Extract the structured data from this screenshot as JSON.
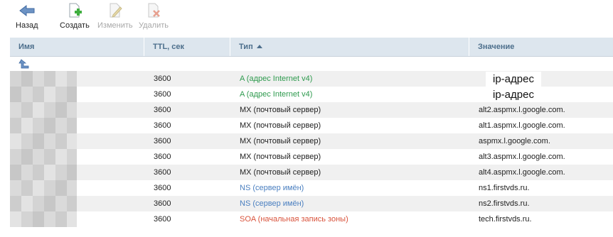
{
  "toolbar": {
    "back_label": "Назад",
    "create_label": "Создать",
    "edit_label": "Изменить",
    "delete_label": "Удалить"
  },
  "columns": {
    "name": "Имя",
    "ttl": "TTL, сек",
    "type": "Тип",
    "value": "Значение"
  },
  "rows": [
    {
      "ttl": "3600",
      "type": "A (адрес Internet v4)",
      "type_class": "a",
      "value": "ip-адрес"
    },
    {
      "ttl": "3600",
      "type": "A (адрес Internet v4)",
      "type_class": "a",
      "value": "ip-адрес"
    },
    {
      "ttl": "3600",
      "type": "MX (почтовый сервер)",
      "type_class": "mx",
      "value": "alt2.aspmx.l.google.com."
    },
    {
      "ttl": "3600",
      "type": "MX (почтовый сервер)",
      "type_class": "mx",
      "value": "alt1.aspmx.l.google.com."
    },
    {
      "ttl": "3600",
      "type": "MX (почтовый сервер)",
      "type_class": "mx",
      "value": "aspmx.l.google.com."
    },
    {
      "ttl": "3600",
      "type": "MX (почтовый сервер)",
      "type_class": "mx",
      "value": "alt3.aspmx.l.google.com."
    },
    {
      "ttl": "3600",
      "type": "MX (почтовый сервер)",
      "type_class": "mx",
      "value": "alt4.aspmx.l.google.com."
    },
    {
      "ttl": "3600",
      "type": "NS (сервер имён)",
      "type_class": "ns",
      "value": "ns1.firstvds.ru."
    },
    {
      "ttl": "3600",
      "type": "NS (сервер имён)",
      "type_class": "ns",
      "value": "ns2.firstvds.ru."
    },
    {
      "ttl": "3600",
      "type": "SOA (начальная запись зоны)",
      "type_class": "soa",
      "value": "tech.firstvds.ru."
    }
  ],
  "colors": {
    "header_bg": "#dde6ee",
    "header_text": "#4d6f8c",
    "type_a": "#2e9a4e",
    "type_ns": "#4a7fc0",
    "type_soa": "#d9533c"
  }
}
